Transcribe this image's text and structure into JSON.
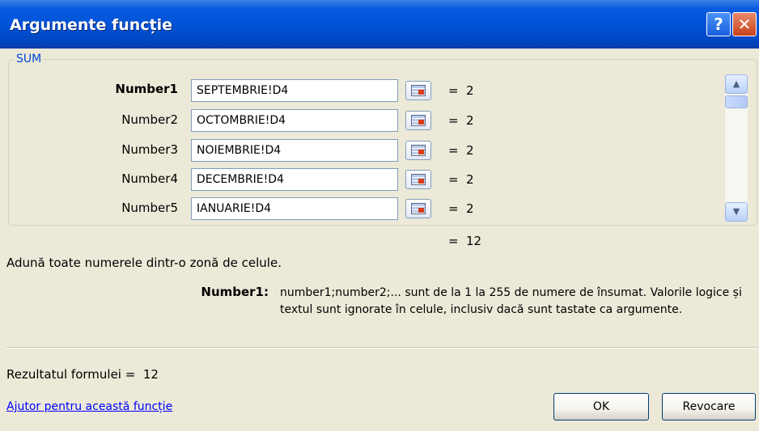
{
  "window": {
    "title": "Argumente funcție",
    "help_glyph": "?",
    "close_glyph": "✕"
  },
  "function": {
    "name": "SUM",
    "arguments": [
      {
        "label": "Number1",
        "value": "SEPTEMBRIE!D4",
        "result": "2"
      },
      {
        "label": "Number2",
        "value": "OCTOMBRIE!D4",
        "result": "2"
      },
      {
        "label": "Number3",
        "value": "NOIEMBRIE!D4",
        "result": "2"
      },
      {
        "label": "Number4",
        "value": "DECEMBRIE!D4",
        "result": "2"
      },
      {
        "label": "Number5",
        "value": "IANUARIE!D4",
        "result": "2"
      }
    ],
    "equals_sign": "=",
    "total": "12",
    "description": "Adună toate numerele dintr-o zonă de celule.",
    "argument_help": {
      "label": "Number1:",
      "text": "number1;number2;... sunt de la 1 la 255 de numere de însumat. Valorile logice și textul sunt ignorate în celule, inclusiv dacă sunt tastate ca argumente."
    }
  },
  "footer": {
    "result_label": "Rezultatul formulei =",
    "result_value": "12",
    "help_link": "Ajutor pentru această funcție",
    "ok_label": "OK",
    "cancel_label": "Revocare"
  },
  "colors": {
    "titlebar": "#0052d6",
    "group_label": "#0046d5",
    "link": "#0000ff"
  },
  "icons": {
    "ref_button": "collapse-dialog-icon",
    "scroll_up": "scroll-up-arrow-icon",
    "scroll_down": "scroll-down-arrow-icon"
  }
}
